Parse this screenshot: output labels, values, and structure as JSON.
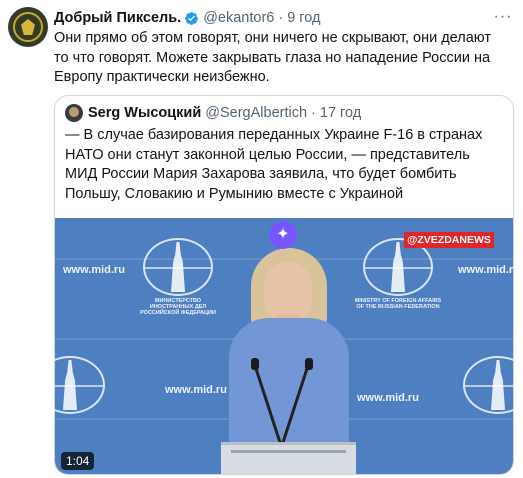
{
  "tweet": {
    "author_name": "Добрый Пиксель.",
    "handle": "@ekantor6",
    "separator": "·",
    "time": "9 год",
    "more_icon": "more-icon",
    "text": "Они прямо об этом говорят, они ничего не скрывают, они делают то что говорят. Можете закрывать глаза но нападение России на Европу практически неизбежно."
  },
  "quote": {
    "author_name": "Serg Wысоцкий",
    "handle": "@SergAlbertich",
    "separator": "·",
    "time": "17 год",
    "text": "— В случае базирования переданных Украине F-16 в странах НАТО они станут законной целью России, — представитель МИД России Мария Захарова заявила, что будет бомбить Польшу, Словакию и Румынию вместе с Украиной",
    "video": {
      "brand_tag": "@ZVEZDANEWS",
      "backdrop_url": "www.mid.ru",
      "emblem_caption_ru": "МИНИСТЕРСТВО ИНОСТРАННЫХ ДЕЛ РОССИЙСКОЙ ФЕДЕРАЦИИ",
      "emblem_caption_en": "MINISTRY OF FOREIGN AFFAIRS OF THE RUSSIAN FEDERATION",
      "duration": "1:04",
      "sparkle_icon": "sparkle-icon"
    }
  },
  "colors": {
    "text": "#0f1419",
    "secondary": "#536471",
    "border": "#cfd9de",
    "verified": "#1d9bf0",
    "backdrop": "#4e7fc1",
    "brand_tag": "#e0262a",
    "sparkle": "#7856ff"
  }
}
